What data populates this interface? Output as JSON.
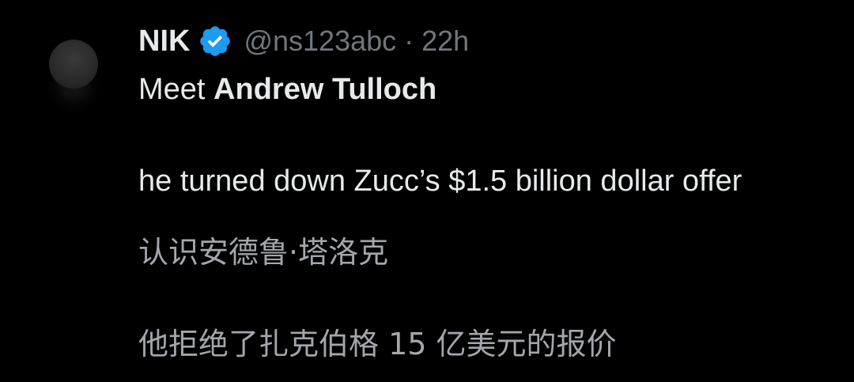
{
  "author": {
    "name": "NIK",
    "handle": "@ns123abc",
    "separator": "·",
    "time": "22h",
    "verified_icon": "verified-badge-icon",
    "verified_color": "#1d9bf0"
  },
  "post": {
    "line1_prefix": "Meet ",
    "line1_bold": "Andrew Tulloch",
    "line2": "he turned down Zucc’s $1.5 billion dollar offer"
  },
  "translation": {
    "line1": "认识安德鲁·塔洛克",
    "line2": "他拒绝了扎克伯格 15 亿美元的报价"
  },
  "colors": {
    "background": "#000000",
    "text": "#e7e9ea",
    "muted": "#71767b",
    "translation": "#a3a7ab"
  }
}
